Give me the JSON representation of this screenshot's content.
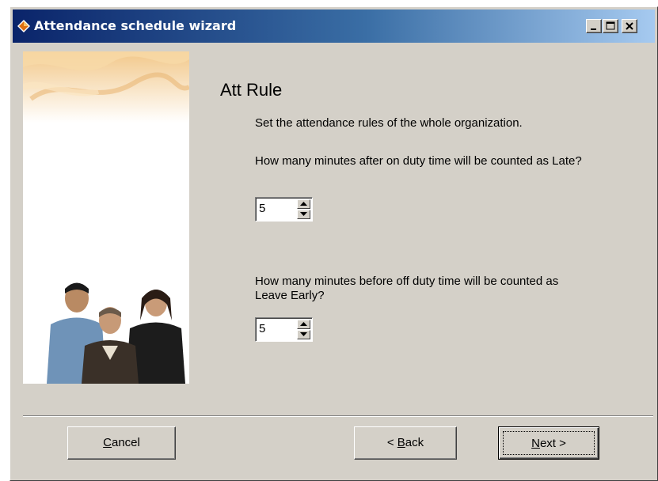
{
  "window": {
    "title": "Attendance schedule wizard",
    "icon": "app-diamond-icon",
    "controls": [
      "minimize-icon",
      "maximize-icon",
      "close-icon"
    ]
  },
  "page": {
    "heading": "Att Rule",
    "intro": "Set the attendance rules of the whole organization."
  },
  "late": {
    "question": "How many minutes after on duty time will be counted as Late?",
    "value": "5"
  },
  "leave_early": {
    "question": "How many minutes before off duty time will be counted as Leave Early?",
    "value": "5"
  },
  "buttons": {
    "cancel": {
      "mnemonic": "C",
      "rest": "ancel"
    },
    "back": {
      "prefix": "< ",
      "mnemonic": "B",
      "rest": "ack"
    },
    "next": {
      "mnemonic": "N",
      "rest": "ext >"
    }
  },
  "colors": {
    "titlebar_start": "#0a246a",
    "titlebar_end": "#a6caf0",
    "dialog_face": "#d4d0c8"
  }
}
